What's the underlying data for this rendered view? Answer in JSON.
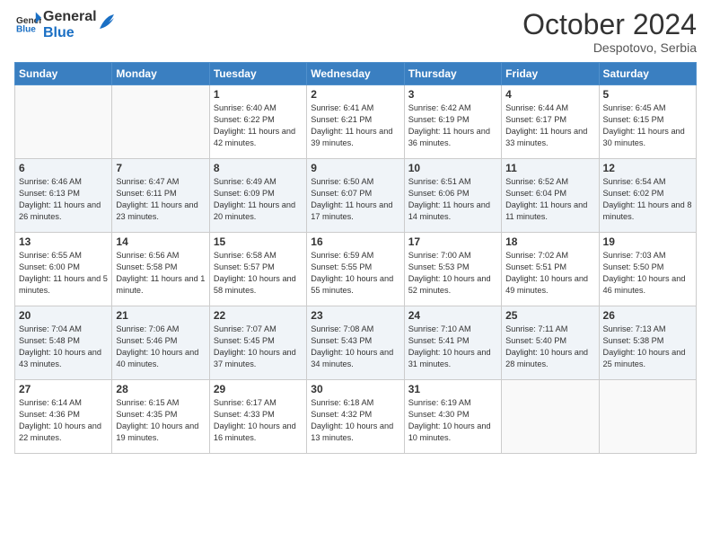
{
  "header": {
    "logo_text_general": "General",
    "logo_text_blue": "Blue",
    "month_title": "October 2024",
    "location": "Despotovo, Serbia"
  },
  "weekdays": [
    "Sunday",
    "Monday",
    "Tuesday",
    "Wednesday",
    "Thursday",
    "Friday",
    "Saturday"
  ],
  "weeks": [
    [
      {
        "day": "",
        "info": ""
      },
      {
        "day": "",
        "info": ""
      },
      {
        "day": "1",
        "info": "Sunrise: 6:40 AM\nSunset: 6:22 PM\nDaylight: 11 hours and 42 minutes."
      },
      {
        "day": "2",
        "info": "Sunrise: 6:41 AM\nSunset: 6:21 PM\nDaylight: 11 hours and 39 minutes."
      },
      {
        "day": "3",
        "info": "Sunrise: 6:42 AM\nSunset: 6:19 PM\nDaylight: 11 hours and 36 minutes."
      },
      {
        "day": "4",
        "info": "Sunrise: 6:44 AM\nSunset: 6:17 PM\nDaylight: 11 hours and 33 minutes."
      },
      {
        "day": "5",
        "info": "Sunrise: 6:45 AM\nSunset: 6:15 PM\nDaylight: 11 hours and 30 minutes."
      }
    ],
    [
      {
        "day": "6",
        "info": "Sunrise: 6:46 AM\nSunset: 6:13 PM\nDaylight: 11 hours and 26 minutes."
      },
      {
        "day": "7",
        "info": "Sunrise: 6:47 AM\nSunset: 6:11 PM\nDaylight: 11 hours and 23 minutes."
      },
      {
        "day": "8",
        "info": "Sunrise: 6:49 AM\nSunset: 6:09 PM\nDaylight: 11 hours and 20 minutes."
      },
      {
        "day": "9",
        "info": "Sunrise: 6:50 AM\nSunset: 6:07 PM\nDaylight: 11 hours and 17 minutes."
      },
      {
        "day": "10",
        "info": "Sunrise: 6:51 AM\nSunset: 6:06 PM\nDaylight: 11 hours and 14 minutes."
      },
      {
        "day": "11",
        "info": "Sunrise: 6:52 AM\nSunset: 6:04 PM\nDaylight: 11 hours and 11 minutes."
      },
      {
        "day": "12",
        "info": "Sunrise: 6:54 AM\nSunset: 6:02 PM\nDaylight: 11 hours and 8 minutes."
      }
    ],
    [
      {
        "day": "13",
        "info": "Sunrise: 6:55 AM\nSunset: 6:00 PM\nDaylight: 11 hours and 5 minutes."
      },
      {
        "day": "14",
        "info": "Sunrise: 6:56 AM\nSunset: 5:58 PM\nDaylight: 11 hours and 1 minute."
      },
      {
        "day": "15",
        "info": "Sunrise: 6:58 AM\nSunset: 5:57 PM\nDaylight: 10 hours and 58 minutes."
      },
      {
        "day": "16",
        "info": "Sunrise: 6:59 AM\nSunset: 5:55 PM\nDaylight: 10 hours and 55 minutes."
      },
      {
        "day": "17",
        "info": "Sunrise: 7:00 AM\nSunset: 5:53 PM\nDaylight: 10 hours and 52 minutes."
      },
      {
        "day": "18",
        "info": "Sunrise: 7:02 AM\nSunset: 5:51 PM\nDaylight: 10 hours and 49 minutes."
      },
      {
        "day": "19",
        "info": "Sunrise: 7:03 AM\nSunset: 5:50 PM\nDaylight: 10 hours and 46 minutes."
      }
    ],
    [
      {
        "day": "20",
        "info": "Sunrise: 7:04 AM\nSunset: 5:48 PM\nDaylight: 10 hours and 43 minutes."
      },
      {
        "day": "21",
        "info": "Sunrise: 7:06 AM\nSunset: 5:46 PM\nDaylight: 10 hours and 40 minutes."
      },
      {
        "day": "22",
        "info": "Sunrise: 7:07 AM\nSunset: 5:45 PM\nDaylight: 10 hours and 37 minutes."
      },
      {
        "day": "23",
        "info": "Sunrise: 7:08 AM\nSunset: 5:43 PM\nDaylight: 10 hours and 34 minutes."
      },
      {
        "day": "24",
        "info": "Sunrise: 7:10 AM\nSunset: 5:41 PM\nDaylight: 10 hours and 31 minutes."
      },
      {
        "day": "25",
        "info": "Sunrise: 7:11 AM\nSunset: 5:40 PM\nDaylight: 10 hours and 28 minutes."
      },
      {
        "day": "26",
        "info": "Sunrise: 7:13 AM\nSunset: 5:38 PM\nDaylight: 10 hours and 25 minutes."
      }
    ],
    [
      {
        "day": "27",
        "info": "Sunrise: 6:14 AM\nSunset: 4:36 PM\nDaylight: 10 hours and 22 minutes."
      },
      {
        "day": "28",
        "info": "Sunrise: 6:15 AM\nSunset: 4:35 PM\nDaylight: 10 hours and 19 minutes."
      },
      {
        "day": "29",
        "info": "Sunrise: 6:17 AM\nSunset: 4:33 PM\nDaylight: 10 hours and 16 minutes."
      },
      {
        "day": "30",
        "info": "Sunrise: 6:18 AM\nSunset: 4:32 PM\nDaylight: 10 hours and 13 minutes."
      },
      {
        "day": "31",
        "info": "Sunrise: 6:19 AM\nSunset: 4:30 PM\nDaylight: 10 hours and 10 minutes."
      },
      {
        "day": "",
        "info": ""
      },
      {
        "day": "",
        "info": ""
      }
    ]
  ]
}
